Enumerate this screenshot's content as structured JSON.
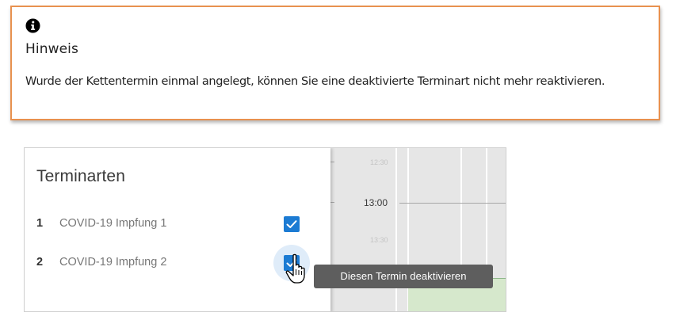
{
  "notice": {
    "icon": "info-icon",
    "title": "Hinweis",
    "text": "Wurde der Kettentermin einmal angelegt, können Sie eine deaktivierte Terminart nicht mehr reaktivieren.",
    "border_color": "#e8914f"
  },
  "panel": {
    "title": "Terminarten",
    "items": [
      {
        "number": "1",
        "label": "COVID-19 Impfung 1",
        "checked": true
      },
      {
        "number": "2",
        "label": "COVID-19 Impfung 2",
        "checked": true
      }
    ],
    "checkbox_color": "#1c7bd3"
  },
  "calendar": {
    "times": [
      "12:30",
      "13:00",
      "13:30"
    ]
  },
  "tooltip": {
    "text": "Diesen Termin deaktivieren"
  },
  "cursor": {
    "icon": "hand-pointer-icon"
  }
}
